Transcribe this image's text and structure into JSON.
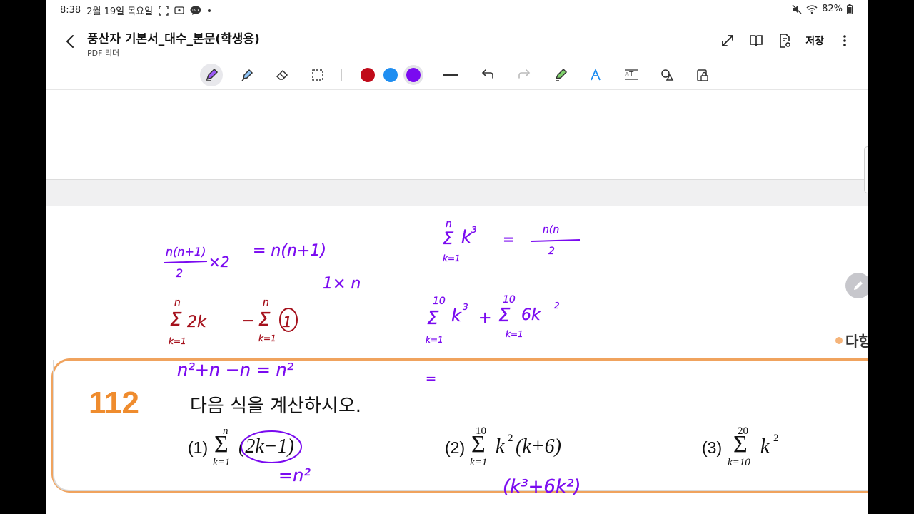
{
  "status_bar": {
    "time": "8:38",
    "date": "2월 19일 목요일",
    "notification_icons": [
      "screenshot-icon",
      "cast-icon",
      "kakaotalk-icon",
      "dot-icon"
    ],
    "battery": "82%",
    "right_icons": [
      "mute-icon",
      "wifi-icon",
      "battery-icon"
    ]
  },
  "title_bar": {
    "title": "풍산자 기본서_대수_본문(학생용)",
    "subtitle": "PDF 리더",
    "save_label": "저장",
    "actions": [
      "expand-icon",
      "book-view-icon",
      "document-settings-icon",
      "more-icon"
    ]
  },
  "toolbar": {
    "tools": [
      "pen-icon",
      "highlighter-icon",
      "eraser-icon",
      "lasso-select-icon"
    ],
    "active_tool": "pen-icon",
    "colors": [
      "#c00b1a",
      "#1f8ef1",
      "#7a0af0"
    ],
    "active_color": "#7a0af0",
    "more_tools": [
      "line-thickness-icon",
      "undo-icon",
      "redo-icon",
      "marker-icon",
      "text-style-icon",
      "text-recognize-icon",
      "shapes-icon",
      "lock-icon"
    ]
  },
  "problem": {
    "number": "112",
    "instruction": "다음 식을 계산하시오.",
    "parts": [
      {
        "label": "(1)",
        "sum_upper": "n",
        "sum_lower": "k=1",
        "body": "(2k−1)"
      },
      {
        "label": "(2)",
        "sum_upper": "10",
        "sum_lower": "k=1",
        "body": "k",
        "power": "2",
        "tail": "(k+6)"
      },
      {
        "label": "(3)",
        "sum_upper": "20",
        "sum_lower": "k=10",
        "body": "k",
        "power": "2"
      }
    ]
  },
  "section_tag": "다항",
  "colors": {
    "accent_orange": "#ef8c2e",
    "ink_purple": "#7a0af0",
    "ink_red": "#a5111c"
  }
}
